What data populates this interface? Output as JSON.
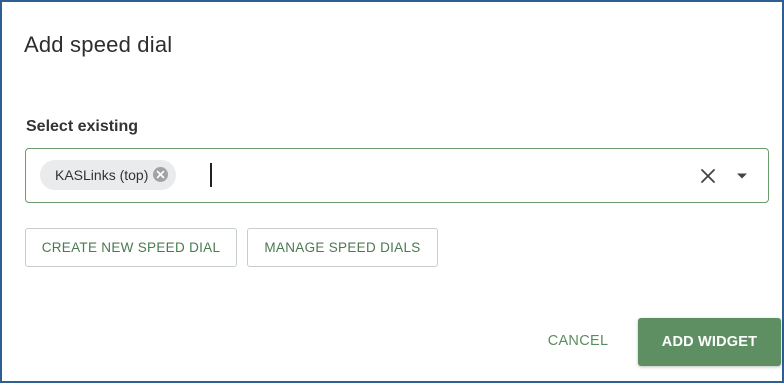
{
  "dialog": {
    "title": "Add speed dial"
  },
  "select": {
    "label": "Select existing",
    "chips": [
      {
        "label": "KASLinks (top)",
        "remove_icon": "circle-x-icon"
      }
    ],
    "input_value": "",
    "clear_icon": "close-icon",
    "dropdown_icon": "caret-down-icon",
    "accent_color": "#6a9a6e"
  },
  "actions": {
    "create_label": "CREATE NEW SPEED DIAL",
    "manage_label": "MANAGE SPEED DIALS",
    "cancel_label": "CANCEL",
    "add_label": "ADD WIDGET"
  },
  "colors": {
    "primary": "#5e8f63",
    "border": "#2f5f8f",
    "text": "#333333"
  }
}
